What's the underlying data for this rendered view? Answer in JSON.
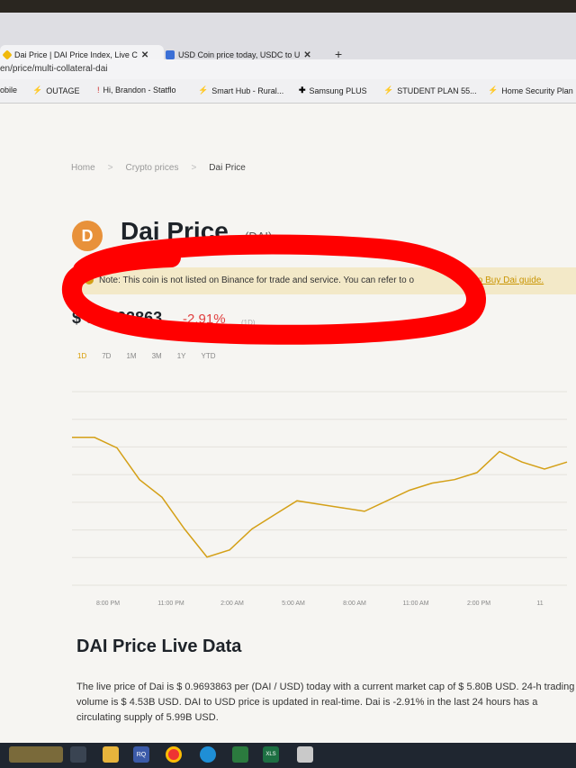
{
  "browser": {
    "tabs": [
      {
        "title": "Dai Price | DAI Price Index, Live C",
        "close": "✕"
      },
      {
        "title": "USD Coin price today, USDC to U",
        "close": "✕"
      }
    ],
    "new_tab": "+",
    "url": "en/price/multi-collateral-dai",
    "bookmarks": [
      "obile",
      "OUTAGE",
      "Hi, Brandon - Statflo",
      "Smart Hub - Rural...",
      "Samsung PLUS",
      "STUDENT PLAN 55...",
      "Home Security Plan"
    ]
  },
  "breadcrumb": {
    "home": "Home",
    "crypto": "Crypto prices",
    "current": "Dai Price",
    "sep": ">"
  },
  "coin": {
    "logo_letter": "D",
    "title": "Dai Price",
    "ticker": "(DAI)"
  },
  "note": {
    "text": "Note: This coin is not listed on Binance for trade and service. You can refer to o",
    "link": "to Buy Dai guide."
  },
  "price": {
    "value": "$ 0.9693863",
    "change": "-2.91%",
    "period": "(1D)"
  },
  "periods": {
    "items": [
      "1D",
      "7D",
      "1M",
      "3M",
      "1Y",
      "YTD"
    ],
    "active": "1D"
  },
  "chart_data": {
    "type": "line",
    "x": [
      "8:00 PM",
      "11:00 PM",
      "2:00 AM",
      "5:00 AM",
      "8:00 AM",
      "11:00 AM",
      "2:00 PM",
      "11"
    ],
    "values": [
      0.9712,
      0.9712,
      0.9709,
      0.97,
      0.9695,
      0.9686,
      0.9678,
      0.968,
      0.9686,
      0.969,
      0.9694,
      0.9693,
      0.9692,
      0.9691,
      0.9694,
      0.9697,
      0.9699,
      0.97,
      0.9702,
      0.9708,
      0.9705,
      0.9703,
      0.9705
    ],
    "color": "#d4a017"
  },
  "live": {
    "title": "DAI Price Live Data",
    "text": "The live price of Dai is $ 0.9693863 per (DAI / USD) today with a current market cap of $ 5.80B USD. 24-h trading volume is $ 4.53B USD. DAI to USD price is updated in real-time. Dai is -2.91% in the last 24 hours has a circulating supply of 5.99B USD."
  },
  "colors": {
    "accent": "#d4a017",
    "negative": "#e04040",
    "annotation": "#ff0000"
  },
  "taskbar": {
    "label": "RQ",
    "excel": "XLS"
  }
}
